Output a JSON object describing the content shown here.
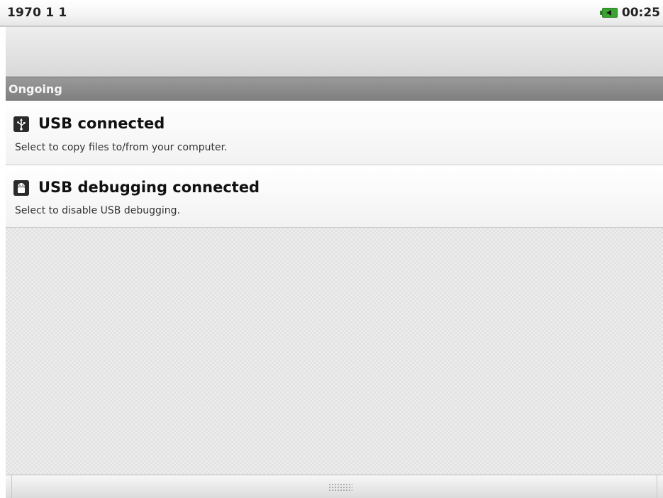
{
  "status_bar": {
    "date": "1970 1 1",
    "time": "00:25",
    "battery_icon": "battery-charging-icon"
  },
  "section": {
    "label": "Ongoing"
  },
  "notifications": [
    {
      "icon": "usb-icon",
      "title": "USB connected",
      "text": "Select to copy files to/from your computer."
    },
    {
      "icon": "android-debug-icon",
      "title": "USB debugging connected",
      "text": "Select to disable USB debugging."
    }
  ],
  "colors": {
    "section_header": "#8a8a8a",
    "battery": "#3aa431"
  }
}
